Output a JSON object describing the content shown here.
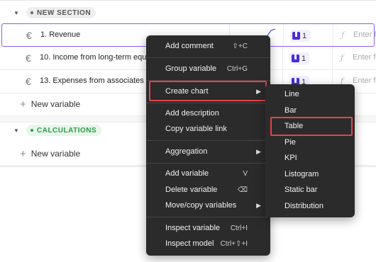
{
  "sections": {
    "new_section": "NEW SECTION",
    "calculations": "CALCULATIONS"
  },
  "variables": [
    {
      "name": "1. Revenue",
      "count": "1",
      "formula_placeholder": "Enter fo"
    },
    {
      "name": "10. Income from long-term equ",
      "count": "1",
      "formula_placeholder": "Enter fo"
    },
    {
      "name": "13. Expenses from associates",
      "count": "1",
      "formula_placeholder": "Enter fo"
    }
  ],
  "new_variable_label": "New variable",
  "currency_symbol": "€",
  "fx_symbol": "ƒ",
  "context_menu": {
    "add_comment": {
      "label": "Add comment",
      "shortcut": "⇧+C"
    },
    "group_variable": {
      "label": "Group variable",
      "shortcut": "Ctrl+G"
    },
    "create_chart": {
      "label": "Create chart"
    },
    "add_description": {
      "label": "Add description"
    },
    "copy_variable_link": {
      "label": "Copy variable link"
    },
    "aggregation": {
      "label": "Aggregation"
    },
    "add_variable": {
      "label": "Add variable",
      "shortcut": "V"
    },
    "delete_variable": {
      "label": "Delete variable",
      "shortcut": "⌫"
    },
    "move_copy_variables": {
      "label": "Move/copy variables"
    },
    "inspect_variable": {
      "label": "Inspect variable",
      "shortcut": "Ctrl+I"
    },
    "inspect_model": {
      "label": "Inspect model",
      "shortcut": "Ctrl+⇧+I"
    }
  },
  "chart_submenu": {
    "items": [
      "Line",
      "Bar",
      "Table",
      "Pie",
      "KPI",
      "Listogram",
      "Static bar",
      "Distribution"
    ],
    "highlighted": "Table"
  },
  "colors": {
    "highlight": "#e0454b",
    "menu_bg": "#2b2b2b",
    "selected_row_border": "#8b5cf6",
    "calc_green": "#2f9a4a"
  }
}
